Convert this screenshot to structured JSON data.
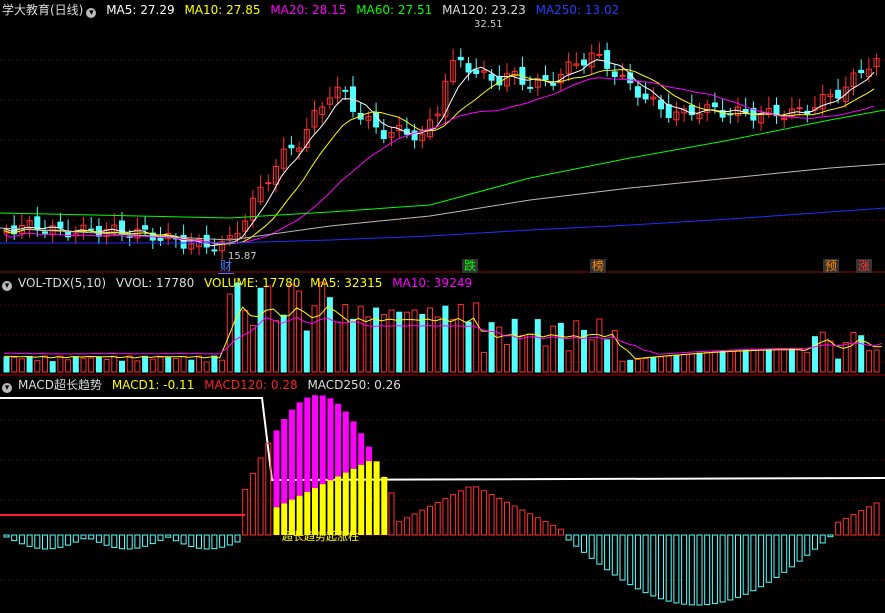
{
  "price_panel": {
    "title": "学大教育(日线)",
    "indicators": [
      {
        "label": "MA5: 27.29",
        "color": "#ffffff"
      },
      {
        "label": "MA10: 27.85",
        "color": "#ffff00"
      },
      {
        "label": "MA20: 28.15",
        "color": "#ff00ff"
      },
      {
        "label": "MA60: 27.51",
        "color": "#00ff00"
      },
      {
        "label": "MA120: 23.23",
        "color": "#dddddd"
      },
      {
        "label": "MA250: 13.02",
        "color": "#0000ff"
      }
    ],
    "high_label": "32.51",
    "low_label": "15.87",
    "markers": [
      {
        "text": "财",
        "color": "#4080ff"
      },
      {
        "text": "跌",
        "color": "#00ff00"
      },
      {
        "text": "榜",
        "color": "#ff8800"
      },
      {
        "text": "预",
        "color": "#ff8800"
      },
      {
        "text": "涨",
        "color": "#ff3030"
      }
    ]
  },
  "volume_panel": {
    "title": "VOL-TDX(5,10)",
    "indicators": [
      {
        "label": "VVOL: 17780",
        "color": "#dddddd"
      },
      {
        "label": "VOLUME: 17780",
        "color": "#ffff00"
      },
      {
        "label": "MA5: 32315",
        "color": "#ffff00"
      },
      {
        "label": "MA10: 39249",
        "color": "#ff00ff"
      }
    ]
  },
  "macd_panel": {
    "title": "MACD超长趋势",
    "indicators": [
      {
        "label": "MACD1: -0.11",
        "color": "#ffff00"
      },
      {
        "label": "MACD120: 0.28",
        "color": "#ff2020"
      },
      {
        "label": "MACD250: 0.26",
        "color": "#dddddd"
      }
    ],
    "annotation": "超长趋势起涨柱"
  },
  "colors": {
    "up": "#ff3030",
    "down": "#54ffff",
    "grid": "#7a0000",
    "background": "#000000"
  },
  "icons": [
    "settings-circle-icon"
  ]
}
